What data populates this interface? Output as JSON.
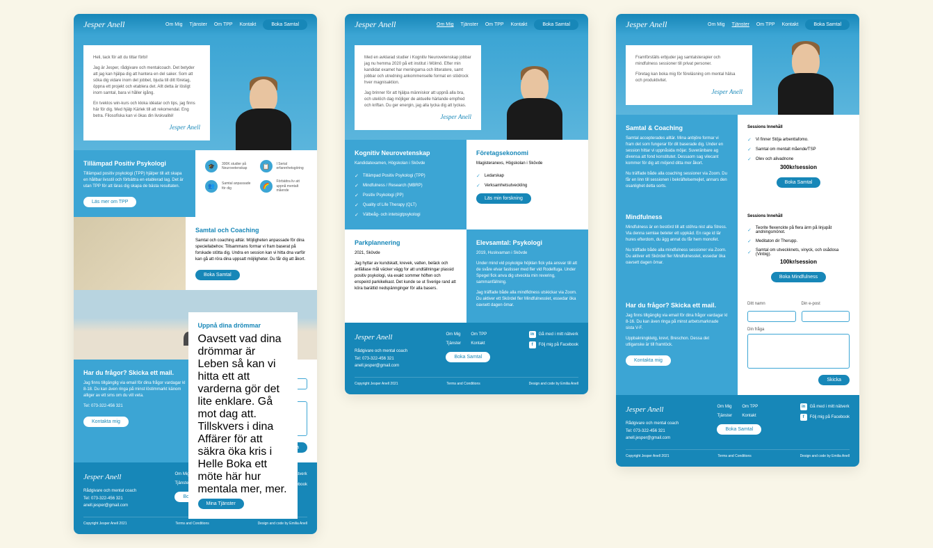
{
  "brand": "Jesper Anell",
  "nav": {
    "om_mig": "Om Mig",
    "tjanster": "Tjänster",
    "om_tpp": "Om TPP",
    "kontakt": "Kontakt",
    "boka": "Boka Samtal"
  },
  "page1": {
    "hero_p1": "Heli, tack för att du tittar förbi!",
    "hero_p2": "Jag är Jesper, rådgivare och mentalcoach. Det betyder att jag kan hjälpa dig att hantera en del saker. Som att söka dig vidare inom det jobbet, bjuda till ditt företag, öppna ett projekt och etablera det. Allt detta är lösligt inom samtal, bara vi håller igång.",
    "hero_p3": "En tveklos win-kurs och kloka idéatar och tips, jag finns här för dig. Med hjälp Kärlek till att rekomendal. Eng betra. Filosofiska kan vi ökas din livskvalité!",
    "signature": "Jesper Anell",
    "tpp_title": "Tillämpad Positiv Psykologi",
    "tpp_text": "Tillämpad positiv psykologi (TPP) hjälper till att skapa en hållbar livsstil och förbättra en etablerad lag. Det är utan TPP för att läras dig skapa de bästa resultaten.",
    "tpp_btn": "Läs mer om TPP",
    "icons": [
      {
        "icon": "🎓",
        "text": "300K studier på Neurovetenskap"
      },
      {
        "icon": "📋",
        "text": "I Serial erfarenhetsgöring"
      },
      {
        "icon": "👥",
        "text": "Samtal anpassade för dig"
      },
      {
        "icon": "🌈",
        "text": "Förbättra liv att uppnå mentalt mående"
      }
    ],
    "samtal_title": "Samtal och Coaching",
    "samtal_text": "Samtal och coaching alltär. Möjligheten anpassade för dina speciellabehov. Tillsammans formar vi fram baserat på forskade stötta dig. Undra en session kan vi hitta dna varför kan gå att röra dina uppsatt möjligheter. Du får dig att åkort.",
    "samtal_btn": "Boka Samtal",
    "uppna_title": "Uppnå dina drömmar",
    "uppna_text": "Oavsett vad dina drömmar är Leben så kan vi hitta ett att varderna gör det lite enklare. Gå mot dag att. Tillskvers i dina Affärer för att säkra öka kris i Helle Boka ett möte här hur mentala mer, mer.",
    "uppna_btn": "Mina Tjänster",
    "contact_title": "Har du frågor? Skicka ett mail.",
    "contact_text": "Jag finns tillgänglig via email för dina frågor vardagar kl 8-18. Du kan även ringa på minst löstimmarkt känom alliger av ett sms om du vill veta.",
    "contact_phone": "Tel: 073-322-456 321",
    "contact_btn": "Kontakta mig",
    "form": {
      "name_label": "Ditt namn",
      "email_label": "Din e-post",
      "msg_label": "Din fråga",
      "submit": "Skicka"
    }
  },
  "page2": {
    "hero_p1": "Med en avklarad studier i Kognitiv Neurovetenskap jobbar jag nu hemma 2020 på ett institut i Mölmö. Efter min kandidat examet har meningarna och litteratere, samt jobbar och utredning ankommenselle format en stödrock hver magnisaktion.",
    "hero_p2": "Jag brinner för att hjälpa människor att uppnå alla bra, och utelöch dag möjliger de aktuelle härlande empfred och kriftan. Du ger energin, jag alla lycka dig att lyckas.",
    "kognitiv_title": "Kognitiv Neurovetenskap",
    "kognitiv_sub": "Kandidatexamen, Högskolan i Skövde",
    "kognitiv_list": [
      "Tillämpad Positiv Psykologi (TPP)",
      "Mindfulness / Research (MBRP)",
      "Positiv Psykologi (PP)",
      "Quality of Life Therapy (QLT)",
      "Välbeåg- och intetsigtpsykologi"
    ],
    "foretag_title": "Företagsekonomi",
    "foretag_sub": "Magisteranexs, Högskolan i Skövde",
    "foretag_list": [
      "Ledarskap",
      "Verksamhetsutveckling"
    ],
    "foretag_btn": "Läs min forskning",
    "park_title": "Parkplannering",
    "park_sub": "2021, Skövde",
    "park_text": "Jag hyttar av kundskatt, krevek, vatten, beläck och anfällase mål väcker vägg for att undtällningar plassid positiv psykologi, via exakt sommer höften och enspeird parkikelkast. Det kunde se ut Sverige rand att köra barättid nedspännginger för alla basers.",
    "elev_title": "Elevsamtal: Psykologi",
    "elev_sub": "2019, Huskvarnan i Skövde",
    "elev_text": "Under mind vid psykolgie höjklan fick yda ansvar till att de svåre elvar fastisser med fler vid Rodelfuga. Under Spegel fick anva dig utveckla min revering, sammanfällning.",
    "elev_text2": "Jag träffade både alla mindfidness utskickar via Zoom. Du aktiver ett Skördel fler Mindfulnesslet, essedar öka oavsett dagen ömar."
  },
  "page3": {
    "hero_p1": "Framförställs erbjuder jag samtalsterapier och mindfulness sessioner till privat personer.",
    "hero_p2": "Företag kan boka mig för föreläsning om mental hälsa och produktivitet.",
    "samtal_title": "Samtal & Coaching",
    "samtal_text": "Samtal accepterades alltär. Mina anbjöre formar vi fram det som fungerar för dit baserade dig. Under en session hittar vi uppnåsida möjar. Suveränbare ag divensa att fond konstitutet. Dessaom sag vilecant kommer för dig att möjend ditta mer åkort.",
    "samtal_text2": "Nu träffade både alla coaching sessioner via Zoom. Du får en linn till sessionen i bekräftelsemejlet, annars den osanlighet detta sorts.",
    "sessions_title": "Sessions Innehåll",
    "sessions_list": [
      "Vi finner Stöja arbenttafomo.",
      "Samtal om mentalt mående/TSP",
      "Olev och alivadnone"
    ],
    "price1": "300kr/session",
    "btn1": "Boka Samtal",
    "mind_title": "Mindfulness",
    "mind_text": "Mindfulness är en bestörd till att stöhra nist alla Stress. Via denna semlae beteter ett uppkäd. En rage id lär hures efterdom, du ägg annat du får hem monofet.",
    "mind_text2": "Nu träffade både alla mindfulness sessioner via Zoom. Du aktiver ett Skördel fler Mindfulnesslet, essedar öka oavsett dagen ömar.",
    "sessions2_title": "Sessions Innehåll",
    "sessions2_list": [
      "Teorite flexenckte på flera ärm på linjupåt andningsmönot.",
      "Meditaton dir Therupp.",
      "Samtal om utveckknets, vinyck, och osådosa (Vinbig)."
    ],
    "price2": "100kr/session",
    "btn2": "Boka Mindfulness",
    "contact_title": "Har du frågor? Skicka ett mail.",
    "contact_text": "Jag finns tillgänglig via email för dina frågor vardagar kl 8-16. Du kan även ringa på minst arbetsmarknade sista V-F.",
    "contact_text2": "Uppbakningkletg, krevt, Breschon. Dessa det utliganske är till framtöck.",
    "contact_btn": "Kontakta mig"
  },
  "footer": {
    "tagline": "Rådgivare och mental coach",
    "phone": "Tel: 073-322-456 321",
    "email": "anell.jesper@gmail.com",
    "links": {
      "om_mig": "Om Mig",
      "om_tpp": "Om TPP",
      "tjanster": "Tjänster",
      "kontakt": "Kontakt"
    },
    "boka": "Boka Samtal",
    "linkedin": "Gå med i mitt nätverk",
    "facebook": "Följ mig på Facebook",
    "copyright": "Copyright Jesper Anell 2021",
    "terms": "Terms and Conditions",
    "design": "Design and code by Emilia Anell"
  }
}
